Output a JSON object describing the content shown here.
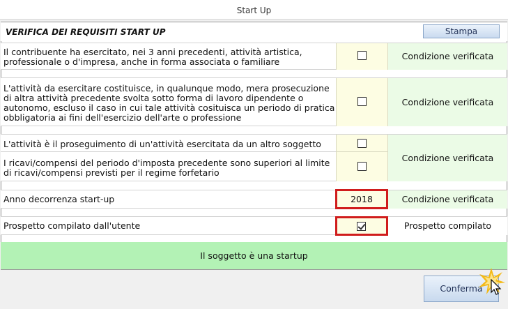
{
  "window": {
    "title": "Start Up"
  },
  "header": {
    "title": "VERIFICA DEI REQUISITI START UP",
    "print_label": "Stampa"
  },
  "rows": [
    {
      "text": "Il contribuente ha esercitato, nei 3 anni precedenti, attività artistica, professionale o d'impresa, anche in forma associata o familiare",
      "checked": false,
      "status": "Condizione verificata"
    },
    {
      "text": "L'attività da esercitare costituisce, in qualunque modo, mera prosecuzione di altra attività precedente svolta sotto forma di lavoro dipendente o autonomo, escluso il caso in cui tale attività cosituisca un periodo di pratica obbligatoria ai fini dell'esercizio dell'arte o professione",
      "checked": false,
      "status": "Condizione verificata"
    },
    {
      "text": "L'attività è il proseguimento di un'attività esercitata da un altro soggetto",
      "checked": false
    },
    {
      "text": "I ricavi/compensi del periodo d'imposta precedente sono superiori al limite di ricavi/compensi previsti per il regime forfetario",
      "checked": false,
      "status": "Condizione verificata"
    }
  ],
  "year_row": {
    "label": "Anno decorrenza start-up",
    "value": "2018",
    "status": "Condizione verificata"
  },
  "compiled_row": {
    "label": "Prospetto compilato dall'utente",
    "checked": true,
    "status": "Prospetto compilato"
  },
  "result": "Il soggetto è una startup",
  "confirm_label": "Conferma",
  "colors": {
    "check_bg": "#fdfde3",
    "status_bg": "#ebfbe6",
    "result_bg": "#b3f2b5",
    "highlight": "#d01c1c"
  }
}
